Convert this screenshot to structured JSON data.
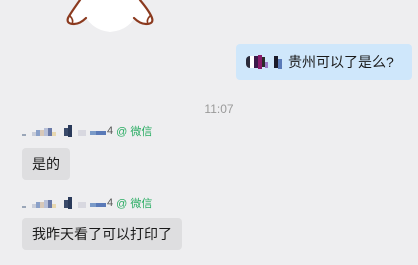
{
  "sticker": {
    "icon": "cartoon-sticker-icon"
  },
  "outgoing": {
    "text": "贵州可以了是么?",
    "avatar_icon": "pixelated-emoji-icon"
  },
  "timestamp": "11:07",
  "messages": [
    {
      "sender_tail": "4",
      "source": "@ 微信",
      "text": "是的"
    },
    {
      "sender_tail": "4",
      "source": "@ 微信",
      "text": "我昨天看了可以打印了"
    }
  ],
  "colors": {
    "background": "#eeeef0",
    "outgoing_bubble": "#cfe7fb",
    "incoming_bubble": "#dedee0",
    "wechat_green": "#2bad64",
    "timestamp": "#9a9a9a"
  }
}
